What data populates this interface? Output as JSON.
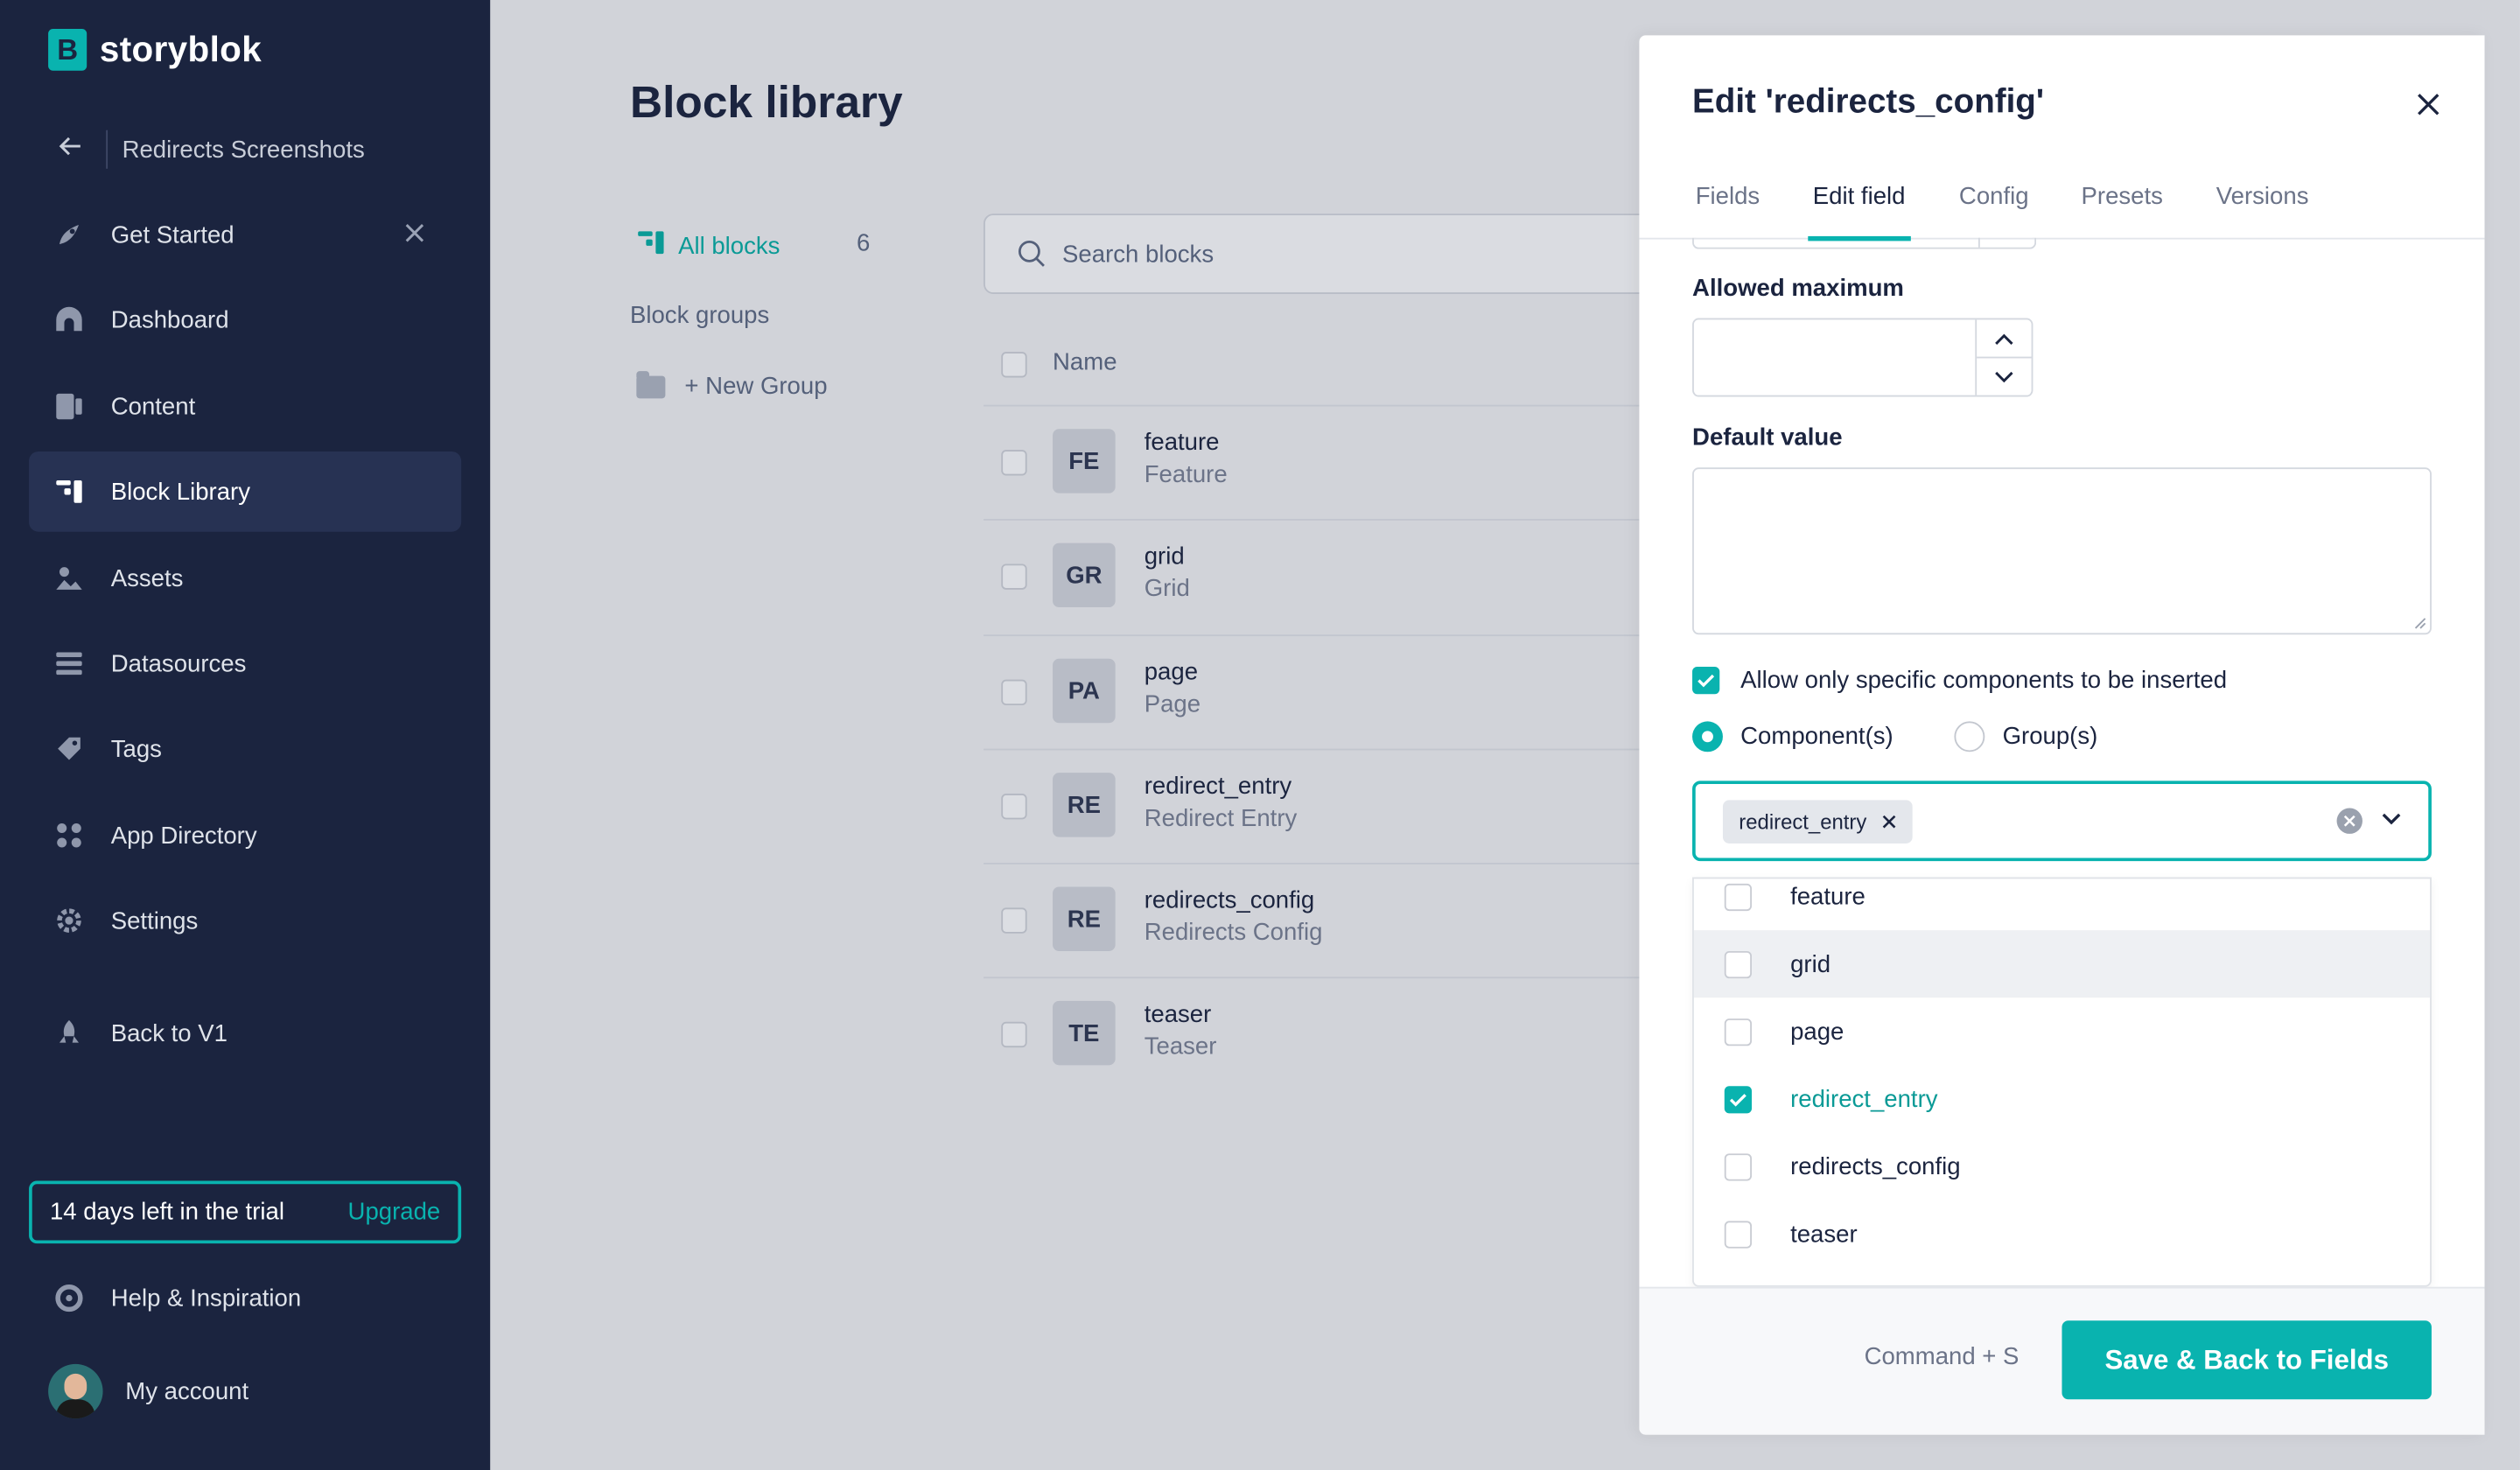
{
  "brand": {
    "name": "storyblok",
    "mark": "B",
    "accent": "#09b3af",
    "sidebar_bg": "#1b243f"
  },
  "space": {
    "name": "Redirects Screenshots"
  },
  "nav": [
    {
      "label": "Get Started",
      "icon": "rocket-icon"
    },
    {
      "label": "Dashboard",
      "icon": "dashboard-icon"
    },
    {
      "label": "Content",
      "icon": "content-icon"
    },
    {
      "label": "Block Library",
      "icon": "block-library-icon",
      "active": true
    },
    {
      "label": "Assets",
      "icon": "assets-icon"
    },
    {
      "label": "Datasources",
      "icon": "datasources-icon"
    },
    {
      "label": "Tags",
      "icon": "tag-icon"
    },
    {
      "label": "App Directory",
      "icon": "apps-icon"
    },
    {
      "label": "Settings",
      "icon": "gear-icon"
    },
    {
      "label": "Back to V1",
      "icon": "rocket-icon"
    }
  ],
  "trial": {
    "text": "14 days left in the trial",
    "upgrade": "Upgrade"
  },
  "help": {
    "label": "Help & Inspiration"
  },
  "account": {
    "label": "My account"
  },
  "library": {
    "title": "Block library",
    "all_blocks": "All blocks",
    "count": "6",
    "groups_label": "Block groups",
    "new_group": "+ New Group",
    "search_placeholder": "Search blocks",
    "col_name": "Name",
    "blocks": [
      {
        "badge": "FE",
        "name": "feature",
        "display": "Feature"
      },
      {
        "badge": "GR",
        "name": "grid",
        "display": "Grid"
      },
      {
        "badge": "PA",
        "name": "page",
        "display": "Page"
      },
      {
        "badge": "RE",
        "name": "redirect_entry",
        "display": "Redirect Entry"
      },
      {
        "badge": "RE",
        "name": "redirects_config",
        "display": "Redirects Config"
      },
      {
        "badge": "TE",
        "name": "teaser",
        "display": "Teaser"
      }
    ]
  },
  "drawer": {
    "title": "Edit 'redirects_config'",
    "tabs": [
      "Fields",
      "Edit field",
      "Config",
      "Presets",
      "Versions"
    ],
    "active_tab": "Edit field",
    "allowed_max_label": "Allowed maximum",
    "default_value_label": "Default value",
    "allow_specific": "Allow only specific components to be inserted",
    "radio_components": "Component(s)",
    "radio_groups": "Group(s)",
    "selected_chip": "redirect_entry",
    "options": [
      {
        "label": "feature",
        "checked": false
      },
      {
        "label": "grid",
        "checked": false
      },
      {
        "label": "page",
        "checked": false
      },
      {
        "label": "redirect_entry",
        "checked": true
      },
      {
        "label": "redirects_config",
        "checked": false
      },
      {
        "label": "teaser",
        "checked": false
      }
    ],
    "shortcut": "Command + S",
    "save_label": "Save & Back to Fields"
  }
}
